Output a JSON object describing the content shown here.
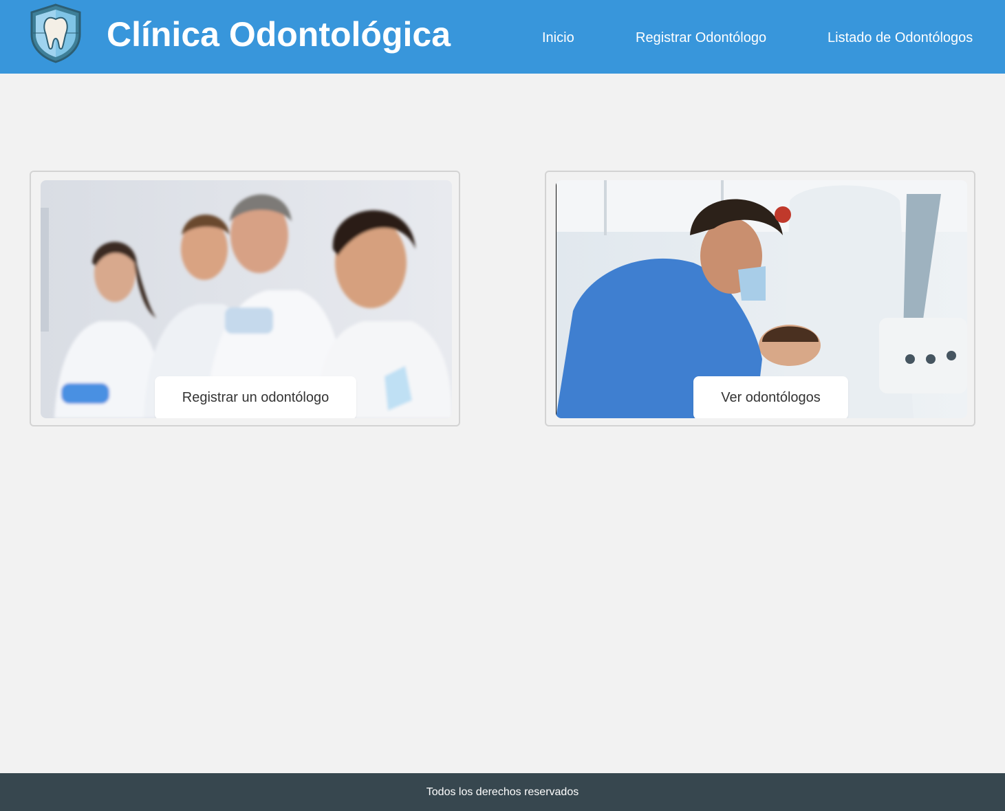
{
  "header": {
    "title": "Clínica Odontológica",
    "logo_icon": "tooth-shield-icon",
    "nav": [
      {
        "label": "Inicio"
      },
      {
        "label": "Registrar Odontólogo"
      },
      {
        "label": "Listado de Odontólogos"
      }
    ]
  },
  "cards": [
    {
      "image": "dentists-team-photo",
      "button_label": "Registrar un odontólogo"
    },
    {
      "image": "dentist-treating-patient-photo",
      "button_label": "Ver odontólogos"
    }
  ],
  "footer": {
    "text": "Todos los derechos reservados"
  },
  "colors": {
    "header_bg": "#3896db",
    "page_bg": "#f2f2f2",
    "footer_bg": "#37474f"
  }
}
